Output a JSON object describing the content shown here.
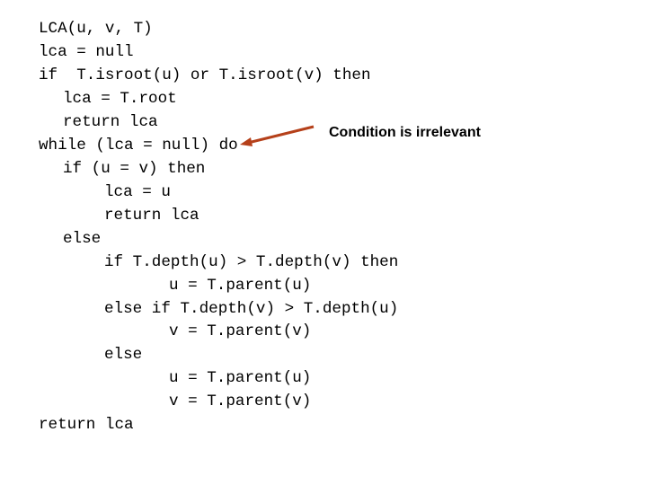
{
  "code_lines": [
    "LCA(u, v, T)",
    "lca = null",
    "if  T.isroot(u) or T.isroot(v) then",
    "lca = T.root",
    "return lca",
    "while (lca = null) do",
    "if (u = v) then",
    "lca = u",
    "return lca",
    "else",
    "if T.depth(u) > T.depth(v) then",
    "u = T.parent(u)",
    "else if T.depth(v) > T.depth(u)",
    "v = T.parent(v)",
    "else",
    "u = T.parent(u)",
    "v = T.parent(v)",
    "return lca"
  ],
  "annotation": {
    "text": "Condition is irrelevant",
    "arrow_color": "#b5401a"
  }
}
